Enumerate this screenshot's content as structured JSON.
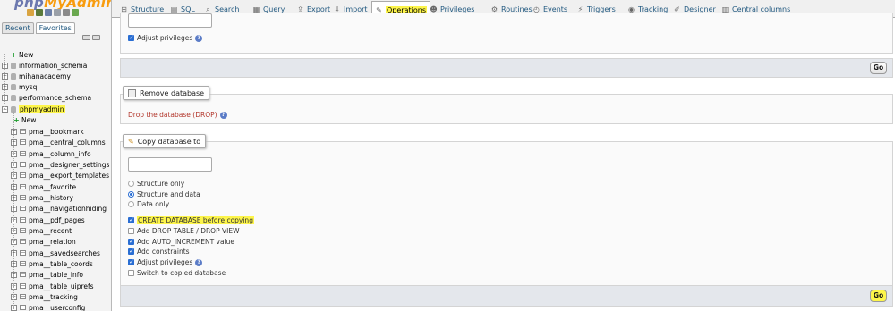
{
  "nav": {
    "logo_left": "php",
    "logo_mid": "MyAdmin",
    "tabs": [
      "Recent",
      "Favorites"
    ],
    "tree": [
      {
        "label": "New",
        "kind": "new"
      },
      {
        "label": "information_schema",
        "kind": "db"
      },
      {
        "label": "mihanacademy",
        "kind": "db"
      },
      {
        "label": "mysql",
        "kind": "db"
      },
      {
        "label": "performance_schema",
        "kind": "db"
      },
      {
        "label": "phpmyadmin",
        "kind": "db",
        "highlighted": true
      },
      {
        "label": "New",
        "kind": "new-child"
      },
      {
        "label": "pma__bookmark",
        "kind": "table"
      },
      {
        "label": "pma__central_columns",
        "kind": "table"
      },
      {
        "label": "pma__column_info",
        "kind": "table"
      },
      {
        "label": "pma__designer_settings",
        "kind": "table"
      },
      {
        "label": "pma__export_templates",
        "kind": "table"
      },
      {
        "label": "pma__favorite",
        "kind": "table"
      },
      {
        "label": "pma__history",
        "kind": "table"
      },
      {
        "label": "pma__navigationhiding",
        "kind": "table"
      },
      {
        "label": "pma__pdf_pages",
        "kind": "table"
      },
      {
        "label": "pma__recent",
        "kind": "table"
      },
      {
        "label": "pma__relation",
        "kind": "table"
      },
      {
        "label": "pma__savedsearches",
        "kind": "table"
      },
      {
        "label": "pma__table_coords",
        "kind": "table"
      },
      {
        "label": "pma__table_info",
        "kind": "table"
      },
      {
        "label": "pma__table_uiprefs",
        "kind": "table"
      },
      {
        "label": "pma__tracking",
        "kind": "table"
      },
      {
        "label": "pma__userconfig",
        "kind": "table"
      }
    ]
  },
  "menu": {
    "tabs": [
      {
        "label": "Structure",
        "icon": "structure-icon"
      },
      {
        "label": "SQL",
        "icon": "sql-icon"
      },
      {
        "label": "Search",
        "icon": "search-icon"
      },
      {
        "label": "Query",
        "icon": "query-icon"
      },
      {
        "label": "Export",
        "icon": "export-icon"
      },
      {
        "label": "Import",
        "icon": "import-icon"
      },
      {
        "label": "Operations",
        "icon": "wrench-icon",
        "active": true
      },
      {
        "label": "Privileges",
        "icon": "privileges-icon"
      },
      {
        "label": "Routines",
        "icon": "routines-icon"
      },
      {
        "label": "Events",
        "icon": "events-icon"
      },
      {
        "label": "Triggers",
        "icon": "triggers-icon"
      },
      {
        "label": "Tracking",
        "icon": "tracking-icon"
      },
      {
        "label": "Designer",
        "icon": "designer-icon"
      },
      {
        "label": "Central columns",
        "icon": "central-columns-icon"
      }
    ]
  },
  "rename_section": {
    "adjust_privileges": "Adjust privileges",
    "go": "Go"
  },
  "remove_section": {
    "title": "Remove database",
    "drop_link": "Drop the database (DROP)"
  },
  "copy_section": {
    "title": "Copy database to",
    "name_value": "",
    "structure_only": "Structure only",
    "structure_and_data": "Structure and data",
    "data_only": "Data only",
    "create_db": "CREATE DATABASE before copying",
    "add_drop": "Add DROP TABLE / DROP VIEW",
    "auto_increment": "Add AUTO_INCREMENT value",
    "constraints": "Add constraints",
    "adjust_privileges": "Adjust privileges",
    "switch_db": "Switch to copied database",
    "go": "Go"
  },
  "colors": {
    "highlight": "#fdf54a",
    "link": "#235a81",
    "danger": "#b3372c",
    "check": "#2a6ed3"
  }
}
